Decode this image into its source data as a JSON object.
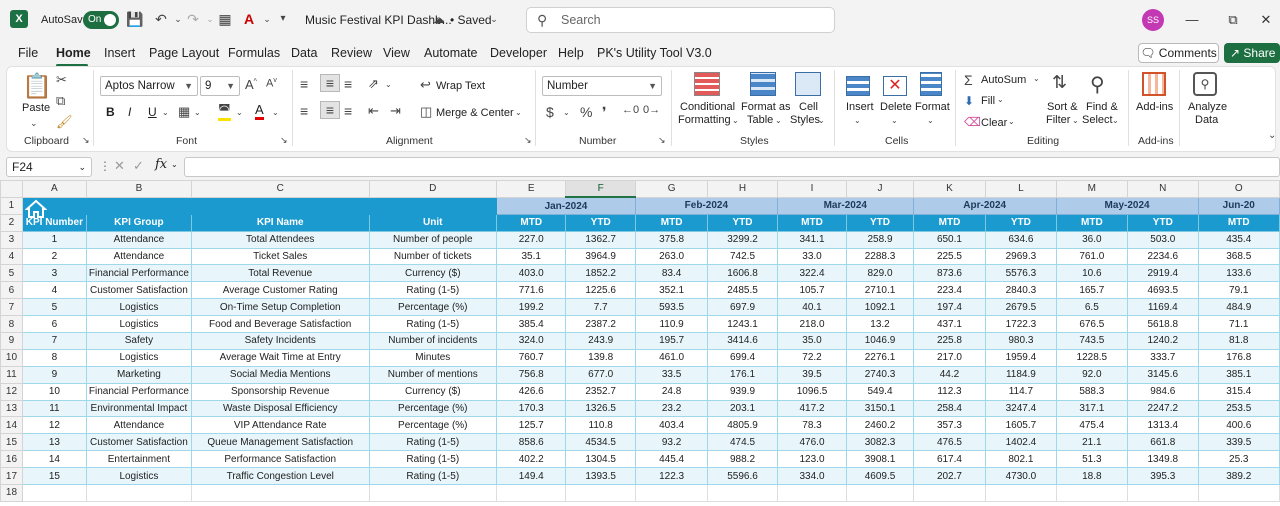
{
  "titlebar": {
    "logo": "X",
    "autosave_label": "AutoSave",
    "autosave_state": "On",
    "file_name": "Music Festival KPI Dashb...",
    "saved_state": "• Saved",
    "search_placeholder": "Search",
    "user_initials": "SS"
  },
  "menu": {
    "items": [
      "File",
      "Home",
      "Insert",
      "Page Layout",
      "Formulas",
      "Data",
      "Review",
      "View",
      "Automate",
      "Developer",
      "Help",
      "PK's Utility Tool V3.0"
    ],
    "active": "Home",
    "comments_label": "Comments",
    "share_label": "Share"
  },
  "ribbon": {
    "clipboard": {
      "paste": "Paste",
      "label": "Clipboard"
    },
    "font": {
      "name": "Aptos Narrow",
      "size": "9",
      "bold": "B",
      "italic": "I",
      "underline": "U",
      "label": "Font"
    },
    "alignment": {
      "wrap_text": "Wrap Text",
      "merge_center": "Merge & Center",
      "label": "Alignment"
    },
    "number": {
      "format": "Number",
      "label": "Number"
    },
    "styles": {
      "conditional": [
        "Conditional",
        "Formatting"
      ],
      "format_table": [
        "Format as",
        "Table"
      ],
      "cell_styles": [
        "Cell",
        "Styles"
      ],
      "label": "Styles"
    },
    "cells": {
      "insert": "Insert",
      "delete": "Delete",
      "format": "Format",
      "label": "Cells"
    },
    "editing": {
      "autosum": "AutoSum",
      "fill": "Fill",
      "clear": "Clear",
      "sort_filter": [
        "Sort &",
        "Filter"
      ],
      "find_select": [
        "Find &",
        "Select"
      ],
      "label": "Editing"
    },
    "addins": {
      "addins": "Add-ins",
      "label": "Add-ins"
    },
    "analyze": {
      "label": [
        "Analyze",
        "Data"
      ]
    }
  },
  "formula_bar": {
    "name_box": "F24",
    "fx": "fx",
    "value": ""
  },
  "sheet": {
    "columns": [
      "A",
      "B",
      "C",
      "D",
      "E",
      "F",
      "G",
      "H",
      "I",
      "J",
      "K",
      "L",
      "M",
      "N",
      "O"
    ],
    "selected_column": "F",
    "months": [
      "Jan-2024",
      "Feb-2024",
      "Mar-2024",
      "Apr-2024",
      "May-2024",
      "Jun-20"
    ],
    "headers": [
      "KPI Number",
      "KPI Group",
      "KPI Name",
      "Unit",
      "MTD",
      "YTD",
      "MTD",
      "YTD",
      "MTD",
      "YTD",
      "MTD",
      "YTD",
      "MTD",
      "YTD",
      "MTD"
    ],
    "rows": [
      [
        "1",
        "Attendance",
        "Total Attendees",
        "Number of people",
        "227.0",
        "1362.7",
        "375.8",
        "3299.2",
        "341.1",
        "258.9",
        "650.1",
        "634.6",
        "36.0",
        "503.0",
        "435.4"
      ],
      [
        "2",
        "Attendance",
        "Ticket Sales",
        "Number of tickets",
        "35.1",
        "3964.9",
        "263.0",
        "742.5",
        "33.0",
        "2288.3",
        "225.5",
        "2969.3",
        "761.0",
        "2234.6",
        "368.5"
      ],
      [
        "3",
        "Financial Performance",
        "Total Revenue",
        "Currency ($)",
        "403.0",
        "1852.2",
        "83.4",
        "1606.8",
        "322.4",
        "829.0",
        "873.6",
        "5576.3",
        "10.6",
        "2919.4",
        "133.6"
      ],
      [
        "4",
        "Customer Satisfaction",
        "Average Customer Rating",
        "Rating (1-5)",
        "771.6",
        "1225.6",
        "352.1",
        "2485.5",
        "105.7",
        "2710.1",
        "223.4",
        "2840.3",
        "165.7",
        "4693.5",
        "79.1"
      ],
      [
        "5",
        "Logistics",
        "On-Time Setup Completion",
        "Percentage (%)",
        "199.2",
        "7.7",
        "593.5",
        "697.9",
        "40.1",
        "1092.1",
        "197.4",
        "2679.5",
        "6.5",
        "1169.4",
        "484.9"
      ],
      [
        "6",
        "Logistics",
        "Food and Beverage Satisfaction",
        "Rating (1-5)",
        "385.4",
        "2387.2",
        "110.9",
        "1243.1",
        "218.0",
        "13.2",
        "437.1",
        "1722.3",
        "676.5",
        "5618.8",
        "71.1"
      ],
      [
        "7",
        "Safety",
        "Safety Incidents",
        "Number of incidents",
        "324.0",
        "243.9",
        "195.7",
        "3414.6",
        "35.0",
        "1046.9",
        "225.8",
        "980.3",
        "743.5",
        "1240.2",
        "81.8"
      ],
      [
        "8",
        "Logistics",
        "Average Wait Time at Entry",
        "Minutes",
        "760.7",
        "139.8",
        "461.0",
        "699.4",
        "72.2",
        "2276.1",
        "217.0",
        "1959.4",
        "1228.5",
        "333.7",
        "176.8"
      ],
      [
        "9",
        "Marketing",
        "Social Media Mentions",
        "Number of mentions",
        "756.8",
        "677.0",
        "33.5",
        "176.1",
        "39.5",
        "2740.3",
        "44.2",
        "1184.9",
        "92.0",
        "3145.6",
        "385.1"
      ],
      [
        "10",
        "Financial Performance",
        "Sponsorship Revenue",
        "Currency ($)",
        "426.6",
        "2352.7",
        "24.8",
        "939.9",
        "1096.5",
        "549.4",
        "112.3",
        "114.7",
        "588.3",
        "984.6",
        "315.4"
      ],
      [
        "11",
        "Environmental Impact",
        "Waste Disposal Efficiency",
        "Percentage (%)",
        "170.3",
        "1326.5",
        "23.2",
        "203.1",
        "417.2",
        "3150.1",
        "258.4",
        "3247.4",
        "317.1",
        "2247.2",
        "253.5"
      ],
      [
        "12",
        "Attendance",
        "VIP Attendance Rate",
        "Percentage (%)",
        "125.7",
        "110.8",
        "403.4",
        "4805.9",
        "78.3",
        "2460.2",
        "357.3",
        "1605.7",
        "475.4",
        "1313.4",
        "400.6"
      ],
      [
        "13",
        "Customer Satisfaction",
        "Queue Management Satisfaction",
        "Rating (1-5)",
        "858.6",
        "4534.5",
        "93.2",
        "474.5",
        "476.0",
        "3082.3",
        "476.5",
        "1402.4",
        "21.1",
        "661.8",
        "339.5"
      ],
      [
        "14",
        "Entertainment",
        "Performance Satisfaction",
        "Rating (1-5)",
        "402.2",
        "1304.5",
        "445.4",
        "988.2",
        "123.0",
        "3908.1",
        "617.4",
        "802.1",
        "51.3",
        "1349.8",
        "25.3"
      ],
      [
        "15",
        "Logistics",
        "Traffic Congestion Level",
        "Rating (1-5)",
        "149.4",
        "1393.5",
        "122.3",
        "5596.6",
        "334.0",
        "4609.5",
        "202.7",
        "4730.0",
        "18.8",
        "395.3",
        "389.2"
      ]
    ],
    "extra_row_number": "18"
  },
  "colors": {
    "header_blue": "#1b9ad0",
    "month_blue": "#aecbea",
    "row_alt": "#e8f6fb",
    "excel_green": "#1d6f42"
  }
}
